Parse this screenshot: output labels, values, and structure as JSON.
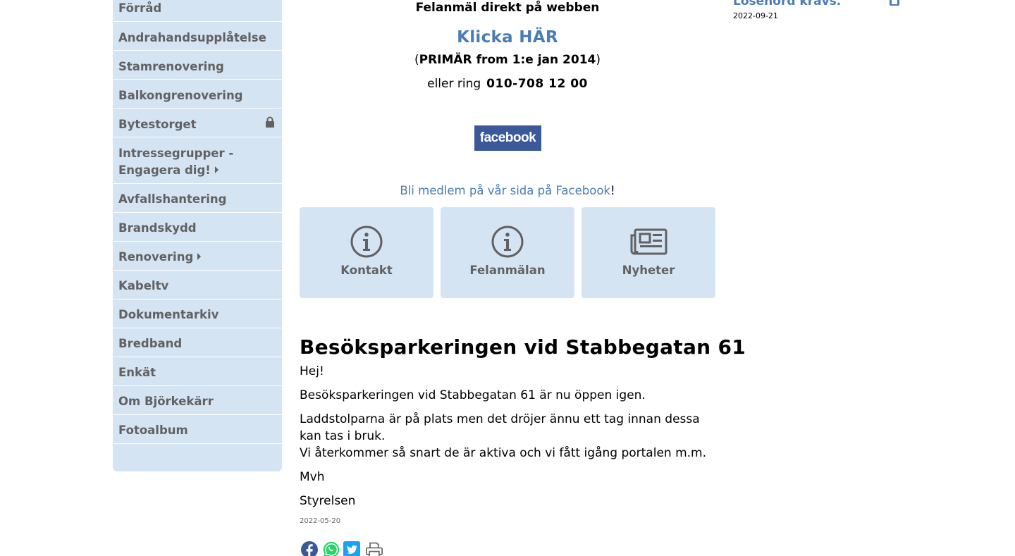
{
  "sidebar": {
    "items": [
      {
        "label": "Förråd"
      },
      {
        "label": "Andrahandsupplåtelse"
      },
      {
        "label": "Stamrenovering"
      },
      {
        "label": "Balkongrenovering"
      },
      {
        "label": "Bytestorget"
      },
      {
        "label": "Intressegrupper -",
        "label2": "Engagera dig!"
      },
      {
        "label": "Avfallshantering"
      },
      {
        "label": "Brandskydd"
      },
      {
        "label": "Renovering"
      },
      {
        "label": "Kabeltv"
      },
      {
        "label": "Dokumentarkiv"
      },
      {
        "label": "Bredband"
      },
      {
        "label": "Enkät"
      },
      {
        "label": "Om Björkekärr"
      },
      {
        "label": "Fotoalbum"
      }
    ]
  },
  "felanmalan": {
    "heading": "Felanmäl direkt på webben",
    "link": "Klicka HÄR",
    "primar_open": "(",
    "primar_bold": "PRIMÄR from 1:e jan 2014",
    "primar_close": ")",
    "ring_text": "eller ring",
    "phone": "010-708 12 00"
  },
  "facebook": {
    "logo_text": "facebook",
    "member_link": "Bli medlem på vår sida på Facebook",
    "member_suffix": "!"
  },
  "tiles": [
    {
      "label": "Kontakt",
      "icon": "info-circle-icon"
    },
    {
      "label": "Felanmälan",
      "icon": "info-circle-icon"
    },
    {
      "label": "Nyheter",
      "icon": "newspaper-icon"
    }
  ],
  "article": {
    "title": "Besöksparkeringen vid Stabbegatan 61",
    "greeting": "Hej!",
    "p1": "Besöksparkeringen vid Stabbegatan 61 är nu öppen igen.",
    "p2a": "Laddstolparna är på plats men det dröjer ännu ett tag innan dessa kan tas i bruk.",
    "p2b": "Vi återkommer så snart de är aktiva och vi fått igång portalen m.m.",
    "signoff": "Mvh",
    "signature": "Styrelsen",
    "date": "2022-05-20"
  },
  "right": {
    "link": "Lösenord krävs.",
    "date": "2022-09-21"
  },
  "colors": {
    "sidebar_bg": "#d5e4f3",
    "link": "#4a7cb5",
    "facebook_blue": "#3b5998",
    "whatsapp_green": "#25d366",
    "twitter_blue": "#1da1f2"
  }
}
